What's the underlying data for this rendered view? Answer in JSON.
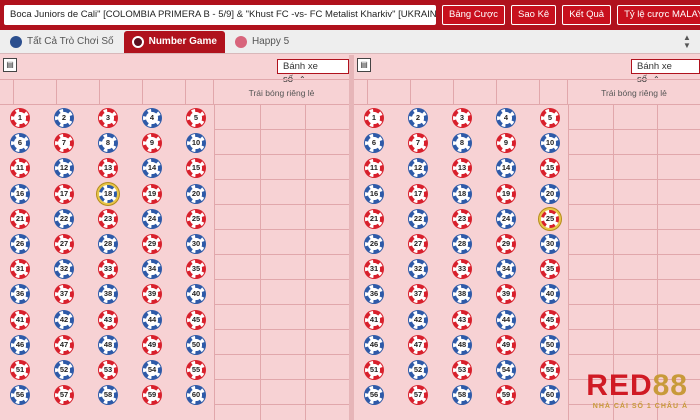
{
  "topbar": {
    "ticker": "Boca Juniors de Cali\" [COLOMBIA PRIMERA B - 5/9] & \"Khust FC -vs- FC Metalist Kharkiv\" [UKRAINE",
    "buttons": [
      {
        "label": "Bảng Cược"
      },
      {
        "label": "Sao Kê"
      },
      {
        "label": "Kết Quả"
      }
    ],
    "odds_select": {
      "label": "Tỷ lệ cược MALAY",
      "icon": "chevron-down-icon"
    }
  },
  "tabs": [
    {
      "label": "Tất Cả Trò Chơi Số",
      "active": false,
      "icon": "all-games-icon"
    },
    {
      "label": "Number Game",
      "active": true,
      "icon": "number-game-icon"
    },
    {
      "label": "Happy 5",
      "active": false,
      "icon": "happy5-icon"
    }
  ],
  "panels": [
    {
      "wheel_label": "Bánh xe số",
      "side_label": "Trái bóng riêng lẻ",
      "highlight": 18
    },
    {
      "wheel_label": "Bánh xe số",
      "side_label": "Trái bóng riêng lẻ",
      "highlight": 25
    }
  ],
  "balls": [
    1,
    2,
    3,
    4,
    5,
    6,
    7,
    8,
    9,
    10,
    11,
    12,
    13,
    14,
    15,
    16,
    17,
    18,
    19,
    20,
    21,
    22,
    23,
    24,
    25,
    26,
    27,
    28,
    29,
    30,
    31,
    32,
    33,
    34,
    35,
    36,
    37,
    38,
    39,
    40,
    41,
    42,
    43,
    44,
    45,
    46,
    47,
    48,
    49,
    50,
    51,
    52,
    53,
    54,
    55,
    56,
    57,
    58,
    59,
    60
  ],
  "colors": {
    "brand_red": "#b0121d",
    "ball_red": "#d8202c",
    "ball_blue": "#2e5aa8",
    "bg_pink": "#f7d2d4"
  },
  "logo": {
    "red": "RED",
    "gold": "88",
    "tagline": "NHÀ CÁI SỐ 1 CHÂU Á"
  }
}
